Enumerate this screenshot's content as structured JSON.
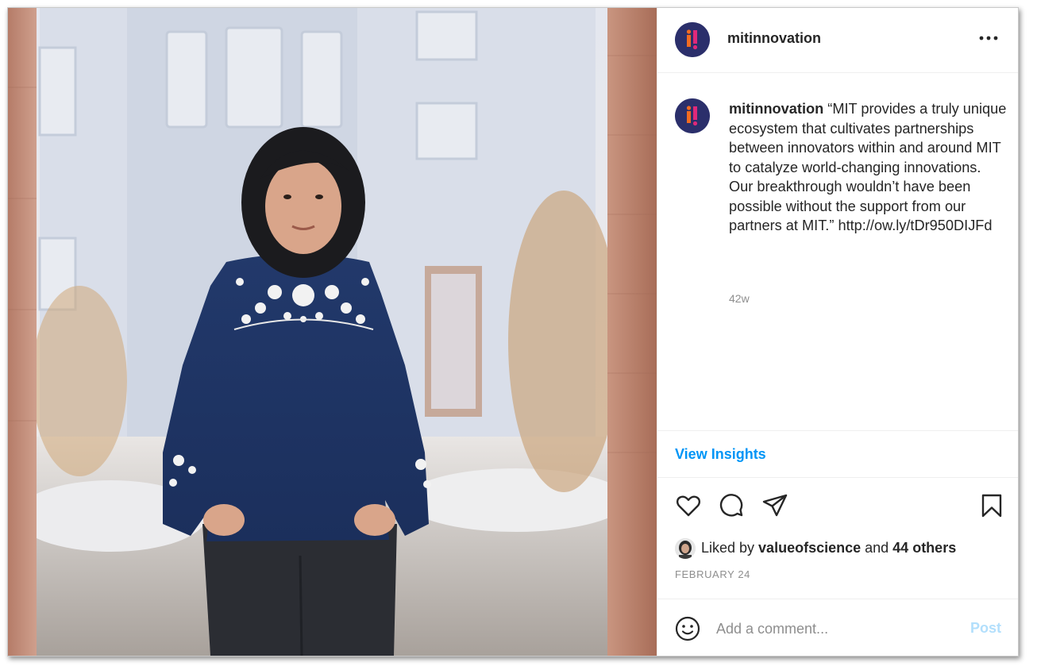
{
  "post": {
    "account": "mitinnovation",
    "photo_alt": "",
    "caption_user": "mitinnovation",
    "caption_text": " “MIT provides a truly unique ecosystem that cultivates partnerships between innovators within and around MIT to catalyze world-changing innovations. Our breakthrough wouldn’t have been possible without the support from our partners at MIT.” http://ow.ly/tDr950DIJFd",
    "time_ago": "42w",
    "view_insights": "View Insights",
    "liked_prefix": "Liked by ",
    "liked_user": "valueofscience",
    "liked_mid": " and ",
    "liked_others": "44 others",
    "date": "FEBRUARY 24",
    "comment_placeholder": "Add a comment...",
    "post_label": "Post"
  },
  "colors": {
    "link_blue": "#0095f6",
    "post_disabled": "#b2dffc",
    "avatar_bg": "#2b2f6b",
    "avatar_accent_orange": "#f26b21",
    "avatar_accent_pink": "#e0287a"
  },
  "icons": [
    "more-icon",
    "heart-icon",
    "comment-icon",
    "share-icon",
    "bookmark-icon",
    "emoji-icon"
  ]
}
